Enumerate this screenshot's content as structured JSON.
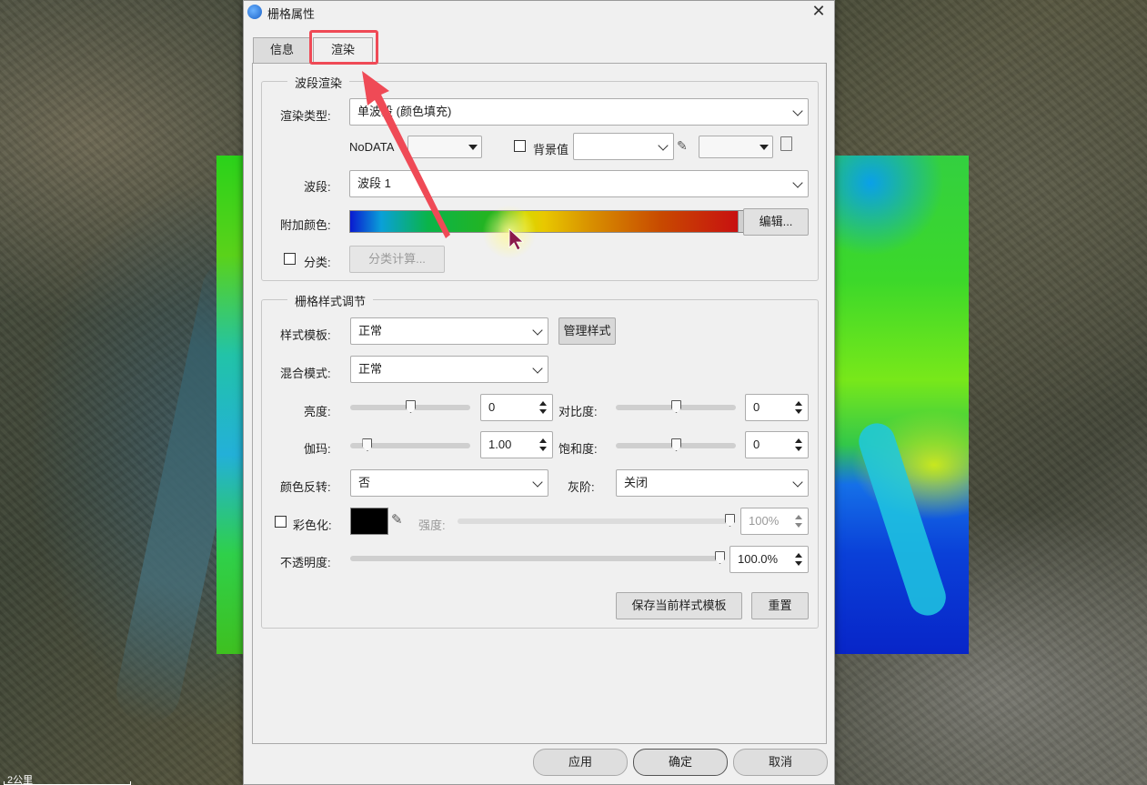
{
  "map": {
    "scale_label": "2公里"
  },
  "dialog": {
    "title": "栅格属性",
    "close_label": "✕",
    "tabs": [
      {
        "label": "信息"
      },
      {
        "label": "渲染"
      }
    ],
    "band_render": {
      "legend": "波段渲染",
      "render_type_label": "渲染类型:",
      "render_type_value": "单波段 (颜色填充)",
      "nodata_label": "NoDATA",
      "bg_value_label": "背景值",
      "band_label": "波段:",
      "band_value": "波段 1",
      "color_label": "附加颜色:",
      "edit_button": "编辑...",
      "classify_label": "分类:",
      "classify_button": "分类计算..."
    },
    "style": {
      "legend": "栅格样式调节",
      "template_label": "样式模板:",
      "template_value": "正常",
      "manage_button": "管理样式",
      "blend_label": "混合模式:",
      "blend_value": "正常",
      "brightness_label": "亮度:",
      "brightness_value": "0",
      "brightness_level": 0.5,
      "contrast_label": "对比度:",
      "contrast_value": "0",
      "contrast_level": 0.5,
      "gamma_label": "伽玛:",
      "gamma_value": "1.00",
      "gamma_level": 0.14,
      "saturation_label": "饱和度:",
      "saturation_value": "0",
      "saturation_level": 0.5,
      "invert_label": "颜色反转:",
      "invert_value": "否",
      "gray_label": "灰阶:",
      "gray_value": "关闭",
      "colorize_label": "彩色化:",
      "intensity_label": "强度:",
      "intensity_value": "100%",
      "intensity_level": 1.0,
      "opacity_label": "不透明度:",
      "opacity_value": "100.0%",
      "opacity_level": 1.0,
      "save_template_button": "保存当前样式模板",
      "reset_button": "重置"
    },
    "footer": {
      "apply": "应用",
      "ok": "确定",
      "cancel": "取消"
    }
  },
  "colors": {
    "highlight": "#ef4a56",
    "colorize_swatch": "#000000"
  }
}
